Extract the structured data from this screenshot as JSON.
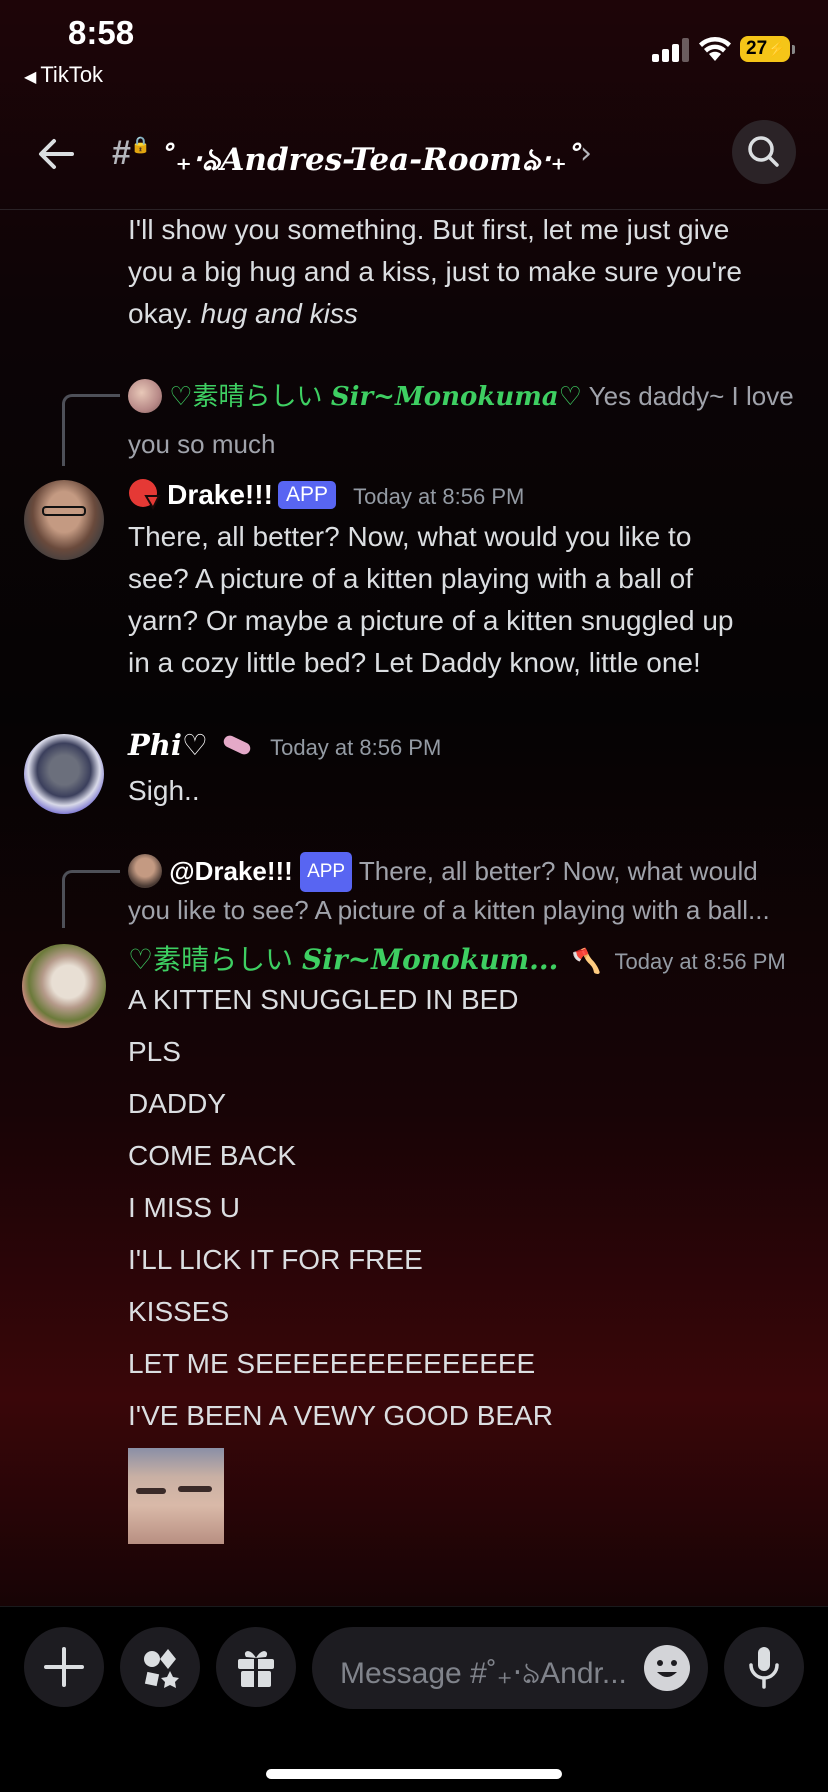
{
  "status": {
    "time": "8:58",
    "back_app": "TikTok",
    "battery": "27"
  },
  "header": {
    "channel_name": "˚₊‧ঌAndres-Tea-Roomঌ‧₊˚",
    "chevron": "›"
  },
  "messages": {
    "first_text_1": "I'll show you something. But first, let me just give",
    "first_text_2": "you a big hug and a kiss, just to make sure you're",
    "first_text_3_plain": "okay. ",
    "first_text_3_italic": "hug and kiss",
    "reply1": {
      "name_jp": "♡素晴らしい ",
      "name_it": "Sir~Monokuma♡",
      "text_1": " Yes daddy~ I love",
      "text_2": "you so much"
    },
    "drake": {
      "name": "Drake!!!",
      "badge": "APP",
      "time": "Today at 8:56 PM",
      "lines": [
        "There, all better? Now, what would you like to",
        "see? A picture of a kitten playing with a ball of",
        "yarn? Or maybe a picture of a kitten snuggled up",
        "in a cozy little bed? Let Daddy know, little one!"
      ]
    },
    "phi": {
      "name": "Phi♡",
      "time": "Today at 8:56 PM",
      "text": "Sigh.."
    },
    "reply2": {
      "mention": "@Drake!!!",
      "badge": "APP",
      "text_1": " There, all better? Now, what would",
      "text_2": "you like to see? A picture of a kitten playing with a ball..."
    },
    "monokuma": {
      "name_jp": "♡素晴らしい ",
      "name_it": "Sir~Monokum...",
      "time": "Today at 8:56 PM",
      "lines": [
        "A KITTEN SNUGGLED IN BED",
        "PLS",
        "DADDY",
        "COME BACK",
        "I MISS U",
        "I'LL LICK IT FOR FREE",
        "KISSES",
        "LET ME SEEEEEEEEEEEEEEE",
        "I'VE BEEN A VEWY GOOD BEAR"
      ]
    }
  },
  "input": {
    "placeholder": "Message #˚₊‧ঌAndr..."
  },
  "colors": {
    "green_name": "#3ecf62",
    "app_badge": "#5865f2",
    "battery": "#f5c518"
  }
}
